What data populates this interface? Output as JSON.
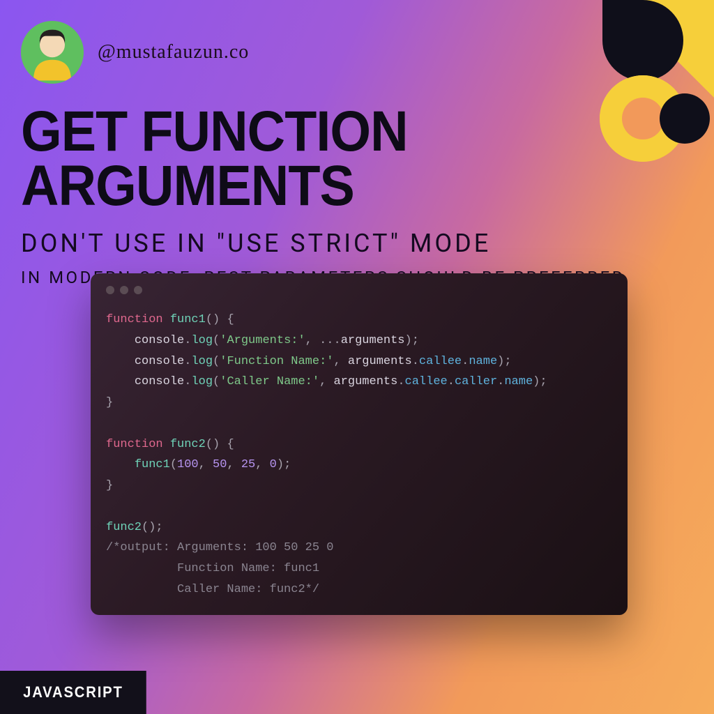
{
  "handle": "@mustafauzun.co",
  "title1": "GET FUNCTION ARGUMENTS",
  "title2": "DON'T USE IN \"USE STRICT\" MODE",
  "title3": "IN MODERN CODE, REST PARAMETERS SHOULD BE PREFERRED",
  "tag": "JAVASCRIPT",
  "colors": {
    "accent_yellow": "#f6cf3a",
    "accent_dark": "#0f0f1a",
    "avatar_bg": "#5fbf5f"
  },
  "code": {
    "l1": {
      "kw": "function",
      "fn": "func1",
      "par": "()",
      "br": " {"
    },
    "l2": {
      "indent": "    ",
      "obj": "console",
      "dot1": ".",
      "method": "log",
      "open": "(",
      "str": "'Arguments:'",
      "comma": ", ",
      "spread": "...",
      "argw": "arguments",
      "close": ");"
    },
    "l3": {
      "indent": "    ",
      "obj": "console",
      "dot1": ".",
      "method": "log",
      "open": "(",
      "str": "'Function Name:'",
      "comma": ", ",
      "argw": "arguments",
      "dot2": ".",
      "p1": "callee",
      "dot3": ".",
      "p2": "name",
      "close": ");"
    },
    "l4": {
      "indent": "    ",
      "obj": "console",
      "dot1": ".",
      "method": "log",
      "open": "(",
      "str": "'Caller Name:'",
      "comma": ", ",
      "argw": "arguments",
      "dot2": ".",
      "p1": "callee",
      "dot3": ".",
      "p2": "caller",
      "dot4": ".",
      "p3": "name",
      "close": ");"
    },
    "l5": {
      "br": "}"
    },
    "l7": {
      "kw": "function",
      "fn": "func2",
      "par": "()",
      "br": " {"
    },
    "l8": {
      "indent": "    ",
      "fn": "func1",
      "open": "(",
      "n1": "100",
      "c1": ", ",
      "n2": "50",
      "c2": ", ",
      "n3": "25",
      "c3": ", ",
      "n4": "0",
      "close": ");"
    },
    "l9": {
      "br": "}"
    },
    "l11": {
      "fn": "func2",
      "par": "();"
    },
    "l12": {
      "txt": "/*output: Arguments: 100 50 25 0"
    },
    "l13": {
      "txt": "          Function Name: func1"
    },
    "l14": {
      "txt": "          Caller Name: func2*/"
    }
  }
}
